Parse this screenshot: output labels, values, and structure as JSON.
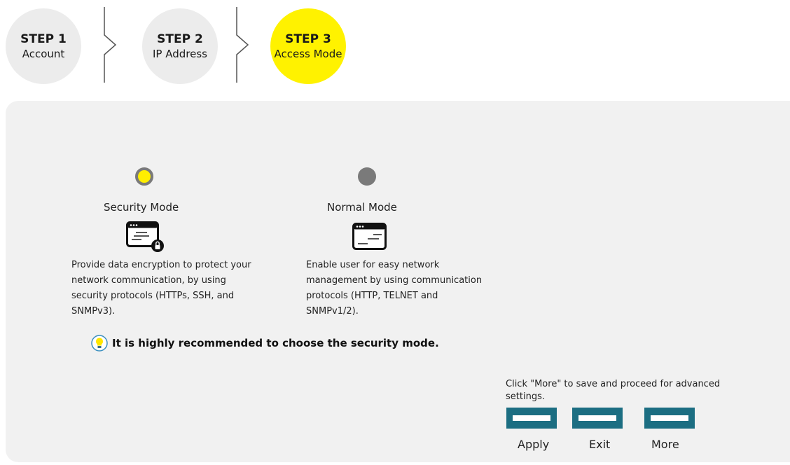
{
  "steps": [
    {
      "number": "STEP 1",
      "label": "Account"
    },
    {
      "number": "STEP 2",
      "label": "IP Address"
    },
    {
      "number": "STEP 3",
      "label": "Access Mode"
    }
  ],
  "active_step": 3,
  "modes": {
    "security": {
      "title": "Security Mode",
      "description": "Provide data encryption to protect your network communication, by using security protocols (HTTPs, SSH, and SNMPv3).",
      "selected": true,
      "icon": "secure-terminal-icon"
    },
    "normal": {
      "title": "Normal Mode",
      "description": "Enable user for easy network management by using communication protocols (HTTP, TELNET and SNMPv1/2).",
      "selected": false,
      "icon": "terminal-icon"
    }
  },
  "tip": {
    "icon": "lightbulb-icon",
    "text": "It is highly recommended to choose the security mode."
  },
  "footer": {
    "note": "Click \"More\" to save and proceed for advanced settings.",
    "buttons": {
      "apply": "Apply",
      "exit": "Exit",
      "more": "More"
    }
  },
  "colors": {
    "accent": "#fff200",
    "button": "#1c6e82",
    "panel": "#f1f1f1",
    "inactive_radio": "#7a7a7a"
  }
}
